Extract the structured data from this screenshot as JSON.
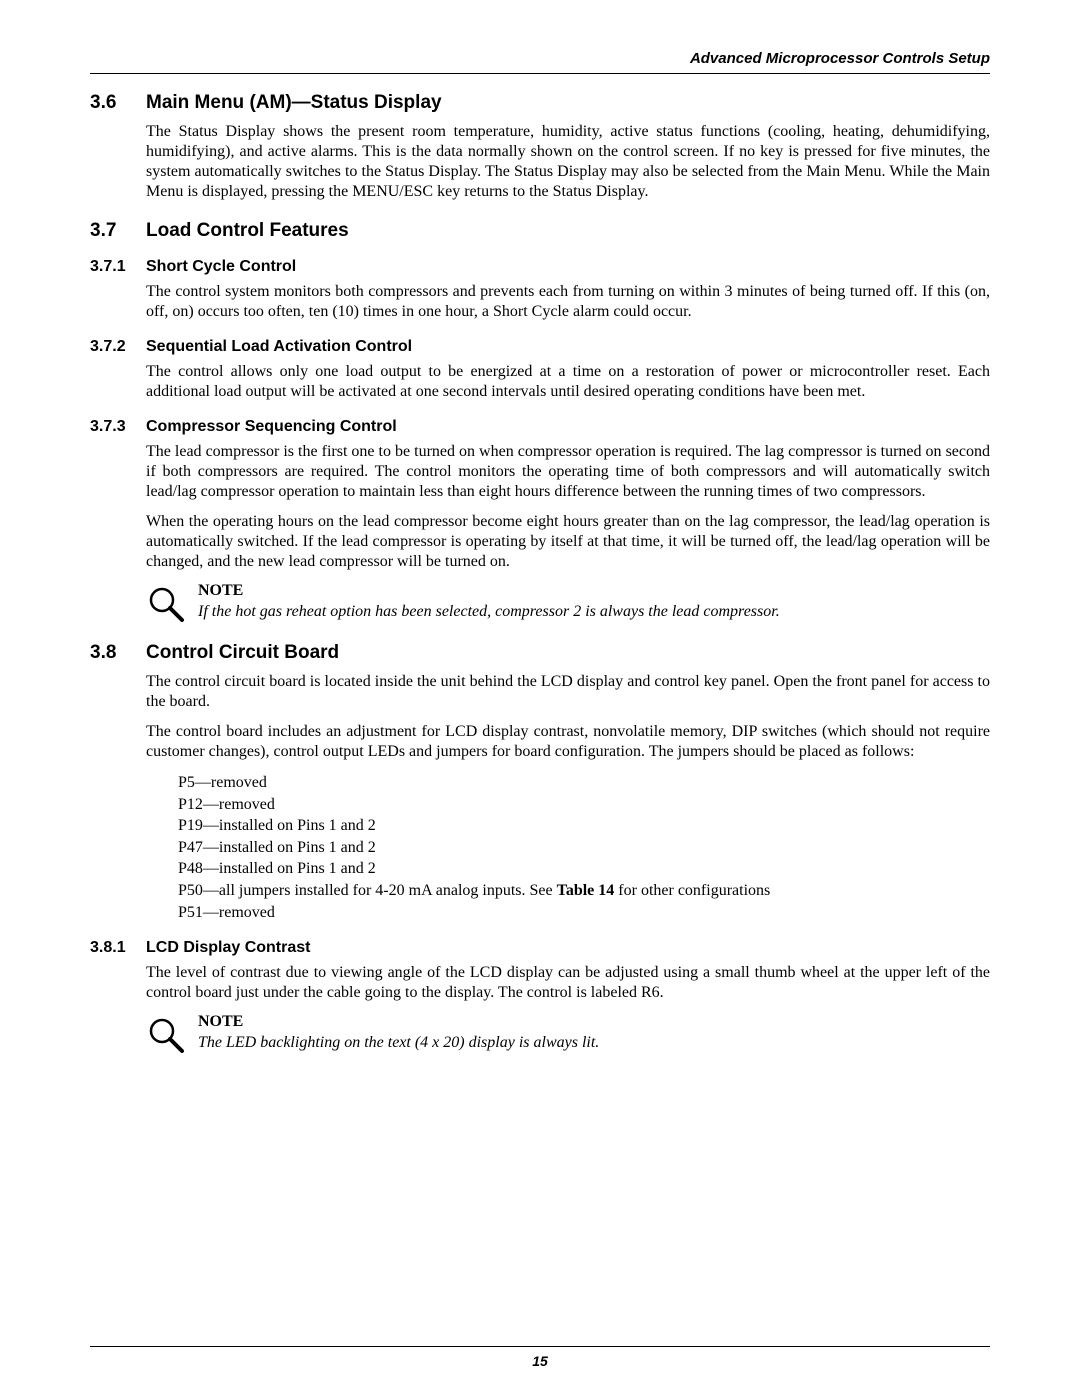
{
  "running_head": "Advanced Microprocessor Controls Setup",
  "page_number": "15",
  "s36": {
    "num": "3.6",
    "title": "Main Menu (AM)—Status Display",
    "p1": "The Status Display shows the present room temperature, humidity, active status functions (cooling, heating, dehumidifying, humidifying), and active alarms. This is the data normally shown on the control screen. If no key is pressed for five minutes, the system automatically switches to the Status Display. The Status Display may also be selected from the Main Menu. While the Main Menu is displayed, pressing the MENU/ESC key returns to the Status Display."
  },
  "s37": {
    "num": "3.7",
    "title": "Load Control Features",
    "s371": {
      "num": "3.7.1",
      "title": "Short Cycle Control",
      "p1": "The control system monitors both compressors and prevents each from turning on within 3 minutes of being turned off. If this (on, off, on) occurs too often, ten (10) times in one hour, a Short Cycle alarm could occur."
    },
    "s372": {
      "num": "3.7.2",
      "title": "Sequential Load Activation Control",
      "p1": "The control allows only one load output to be energized at a time on a restoration of power or microcontroller reset. Each additional load output will be activated at one second intervals until desired operating conditions have been met."
    },
    "s373": {
      "num": "3.7.3",
      "title": "Compressor Sequencing Control",
      "p1": "The lead compressor is the first one to be turned on when compressor operation is required. The lag compressor is turned on second if both compressors are required. The control monitors the operating time of both compressors and will automatically switch lead/lag compressor operation to maintain less than eight hours difference between the running times of two compressors.",
      "p2": "When the operating hours on the lead compressor become eight hours greater than on the lag compressor, the lead/lag operation is automatically switched. If the lead compressor is operating by itself at that time, it will be turned off, the lead/lag operation will be changed, and the new lead compressor will be turned on.",
      "note_head": "NOTE",
      "note_body": "If the hot gas reheat option has been selected, compressor 2 is always the lead compressor."
    }
  },
  "s38": {
    "num": "3.8",
    "title": "Control Circuit Board",
    "p1": "The control circuit board is located inside the unit behind the LCD display and control key panel. Open the front panel for access to the board.",
    "p2": "The control board includes an adjustment for LCD display contrast, nonvolatile memory, DIP switches (which should not require customer changes), control output LEDs and jumpers for board configuration. The jumpers should be placed as follows:",
    "jumpers": {
      "j0": "P5—removed",
      "j1": "P12—removed",
      "j2": "P19—installed on Pins 1 and 2",
      "j3": "P47—installed on Pins 1 and 2",
      "j4": "P48—installed on Pins 1 and 2",
      "j5_pre": "P50—all jumpers installed for 4-20 mA analog inputs. See ",
      "j5_bold": "Table 14",
      "j5_post": " for other configurations",
      "j6": "P51—removed"
    },
    "s381": {
      "num": "3.8.1",
      "title": "LCD Display Contrast",
      "p1": "The level of contrast due to viewing angle of the LCD display can be adjusted using a small thumb wheel at the upper left of the control board just under the cable going to the display. The control is labeled R6.",
      "note_head": "NOTE",
      "note_body": "The LED backlighting on the text (4 x 20) display is always lit."
    }
  }
}
